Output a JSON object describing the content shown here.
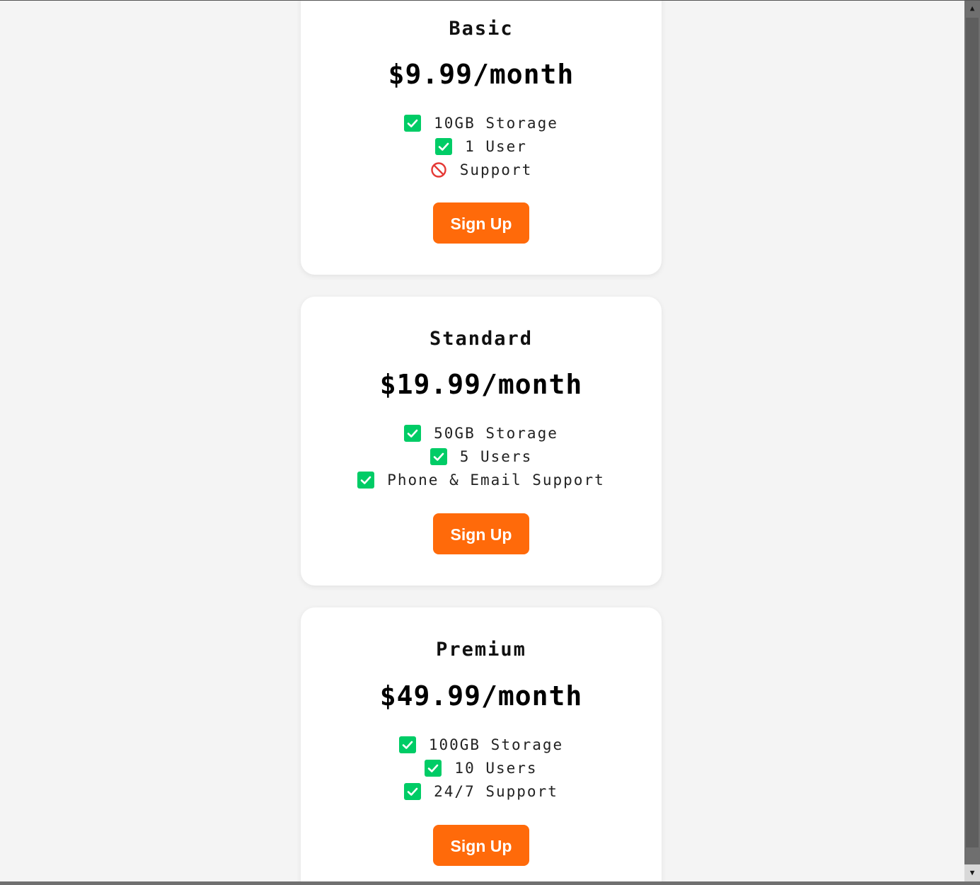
{
  "plans": [
    {
      "name": "Basic",
      "price": "$9.99/month",
      "features": [
        {
          "text": "10GB Storage",
          "icon": "check-icon"
        },
        {
          "text": "1 User",
          "icon": "check-icon"
        },
        {
          "text": "Support",
          "icon": "prohibited-icon"
        }
      ],
      "button": "Sign Up"
    },
    {
      "name": "Standard",
      "price": "$19.99/month",
      "features": [
        {
          "text": "50GB Storage",
          "icon": "check-icon"
        },
        {
          "text": "5 Users",
          "icon": "check-icon"
        },
        {
          "text": "Phone & Email Support",
          "icon": "check-icon"
        }
      ],
      "button": "Sign Up"
    },
    {
      "name": "Premium",
      "price": "$49.99/month",
      "features": [
        {
          "text": "100GB Storage",
          "icon": "check-icon"
        },
        {
          "text": "10 Users",
          "icon": "check-icon"
        },
        {
          "text": "24/7 Support",
          "icon": "check-icon"
        }
      ],
      "button": "Sign Up"
    }
  ],
  "colors": {
    "page_background": "#f4f4f4",
    "card_background": "#ffffff",
    "button": "#ff6a0a",
    "check": "#00cc66",
    "prohibited": "#e53935"
  }
}
